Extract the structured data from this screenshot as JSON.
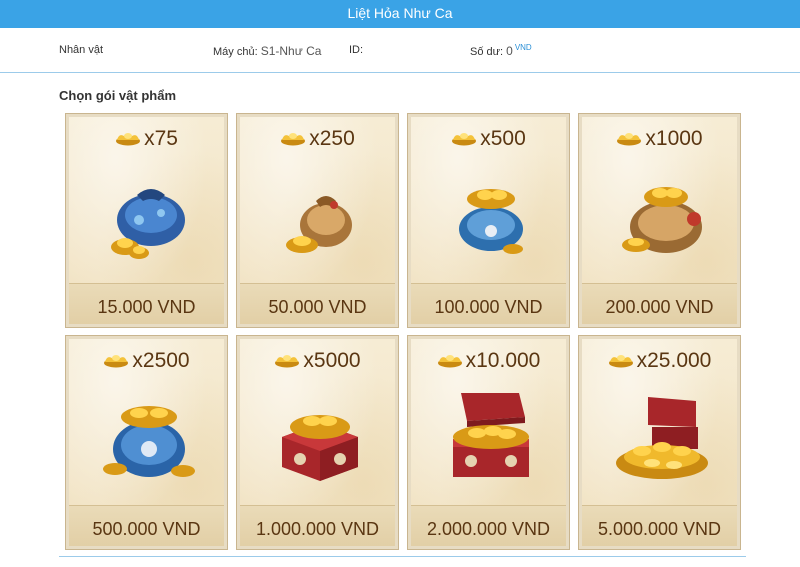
{
  "app": {
    "title": "Liệt Hỏa Như Ca"
  },
  "info": {
    "character_label": "Nhân vật",
    "server_label": "Máy chủ:",
    "server_value": "S1-Như Ca",
    "id_label": "ID:",
    "balance_label": "Số dư:",
    "balance_value": "0",
    "balance_unit": "VND"
  },
  "section_title": "Chọn gói vật phẩm",
  "packages": [
    {
      "qty": "x75",
      "price": "15.000 VND",
      "icon": "blue-pouch-icon"
    },
    {
      "qty": "x250",
      "price": "50.000 VND",
      "icon": "tan-pouch-icon"
    },
    {
      "qty": "x500",
      "price": "100.000 VND",
      "icon": "blue-gold-pouch-icon"
    },
    {
      "qty": "x1000",
      "price": "200.000 VND",
      "icon": "large-tan-pouch-icon"
    },
    {
      "qty": "x2500",
      "price": "500.000 VND",
      "icon": "blue-gold-sack-icon"
    },
    {
      "qty": "x5000",
      "price": "1.000.000 VND",
      "icon": "red-gold-box-icon"
    },
    {
      "qty": "x10.000",
      "price": "2.000.000 VND",
      "icon": "red-treasure-chest-icon"
    },
    {
      "qty": "x25.000",
      "price": "5.000.000 VND",
      "icon": "gold-pile-chest-icon"
    }
  ],
  "colors": {
    "header": "#3aa3e6",
    "card_text": "#5a3612",
    "accent": "#2a8fd6"
  }
}
